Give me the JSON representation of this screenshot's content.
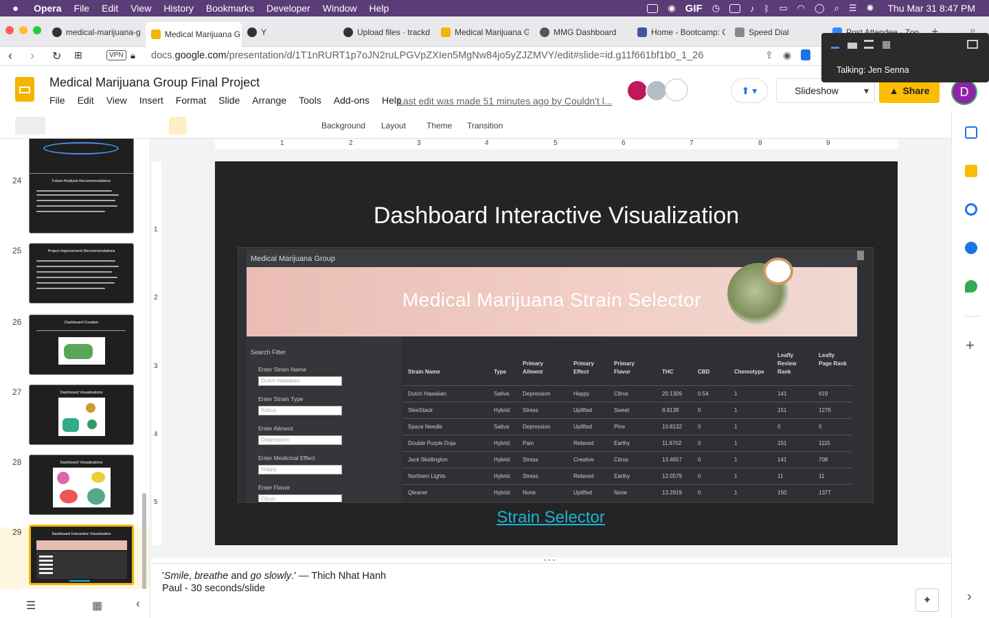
{
  "macos_menubar": {
    "app": "Opera",
    "menus": [
      "File",
      "Edit",
      "View",
      "History",
      "Bookmarks",
      "Developer",
      "Window",
      "Help"
    ],
    "datetime": "Thu Mar 31  8:47 PM"
  },
  "browser": {
    "tabs": [
      {
        "label": "medical-marijuana-g",
        "icon": "github-icon"
      },
      {
        "label": "Medical Marijuana G",
        "icon": "slides-icon",
        "active": true
      },
      {
        "label": "Y",
        "icon": "github-icon"
      },
      {
        "label": "Upload files · trackd",
        "icon": "github-icon"
      },
      {
        "label": "Medical Marijuana G",
        "icon": "slides-icon"
      },
      {
        "label": "MMG Dashboard",
        "icon": "globe-icon"
      },
      {
        "label": "Home - Bootcamp: C",
        "icon": "bootcamp-icon"
      },
      {
        "label": "Speed Dial",
        "icon": "grid-icon"
      },
      {
        "label": "Post Attendee - Zoo",
        "icon": "zoom-icon"
      }
    ],
    "vpn_label": "VPN",
    "url_prefix": "docs.",
    "url_domain": "google.com",
    "url_path": "/presentation/d/1T1nRURT1p7oJN2ruLPGVpZXIen5MgNw84jo5yZJZMVY/edit#slide=id.g11f661bf1b0_1_26"
  },
  "zoom_popup": {
    "talking": "Talking: Jen Senna"
  },
  "document": {
    "title": "Medical Marijuana Group Final Project",
    "menus": [
      "File",
      "Edit",
      "View",
      "Insert",
      "Format",
      "Slide",
      "Arrange",
      "Tools",
      "Add-ons",
      "Help"
    ],
    "last_edit": "Last edit was made 51 minutes ago by Couldn't l...",
    "slideshow_label": "Slideshow",
    "share_label": "Share",
    "avatar_letter": "D"
  },
  "toolbar": {
    "background": "Background",
    "layout": "Layout",
    "theme": "Theme",
    "transition": "Transition"
  },
  "ruler": {
    "h_ticks": [
      "1",
      "2",
      "3",
      "4",
      "5",
      "6",
      "7",
      "8",
      "9"
    ],
    "v_ticks": [
      "1",
      "2",
      "3",
      "4",
      "5"
    ]
  },
  "filmstrip": [
    {
      "num": "24",
      "title": "Future Analysis Recommendations"
    },
    {
      "num": "25",
      "title": "Project Improvement Recommendations"
    },
    {
      "num": "26",
      "title": "Dashboard Creation"
    },
    {
      "num": "27",
      "title": "Dashboard Visualizations"
    },
    {
      "num": "28",
      "title": "Dashboard Visualizations"
    },
    {
      "num": "29",
      "title": "Dashboard Interactive Visualization",
      "selected": true
    }
  ],
  "slide": {
    "title": "Dashboard Interactive Visualization",
    "link_text": "Strain Selector",
    "dashboard": {
      "header": "Medical Marijuana Group",
      "banner": "Medical Marijuana Strain Selector",
      "filter_title": "Search Filter",
      "filters": [
        {
          "label": "Enter Strain Name",
          "value": "Dutch Hawaiian"
        },
        {
          "label": "Enter Strain Type",
          "value": "Sativa"
        },
        {
          "label": "Enter Ailment",
          "value": "Depression"
        },
        {
          "label": "Enter Medicinal Effect",
          "value": "Happy"
        },
        {
          "label": "Enter Flavor",
          "value": "Citrus"
        }
      ],
      "columns": [
        "Strain Name",
        "Type",
        "Primary Ailment",
        "Primary Effect",
        "Primary Flavor",
        "THC",
        "CBD",
        "Chemotype",
        "Leafly Review Rank",
        "Leafly Page Rank"
      ],
      "rows": [
        [
          "Dutch Hawaiian",
          "Sativa",
          "Depression",
          "Happy",
          "Citrus",
          "20.1309",
          "0.54",
          "1",
          "141",
          "619"
        ],
        [
          "SleeStack",
          "Hybrid",
          "Stress",
          "Uplifted",
          "Sweet",
          "9.9139",
          "0",
          "1",
          "151",
          "1276"
        ],
        [
          "Space Needle",
          "Sativa",
          "Depression",
          "Uplifted",
          "Pine",
          "10.8132",
          "0",
          "1",
          "0",
          "0"
        ],
        [
          "Double Purple Doja",
          "Hybrid",
          "Pain",
          "Relaxed",
          "Earthy",
          "11.6702",
          "0",
          "1",
          "151",
          "1115"
        ],
        [
          "Jack Skellington",
          "Hybrid",
          "Stress",
          "Creative",
          "Citrus",
          "13.4657",
          "0",
          "1",
          "141",
          "708"
        ],
        [
          "Northern Lights",
          "Hybrid",
          "Stress",
          "Relaxed",
          "Earthy",
          "12.0579",
          "0",
          "1",
          "11",
          "11"
        ],
        [
          "Qleaner",
          "Hybrid",
          "None",
          "Uplifted",
          "None",
          "13.2919",
          "0",
          "1",
          "150",
          "1377"
        ]
      ]
    }
  },
  "notes": {
    "line1_a": "'",
    "line1_smile": "Smile",
    "line1_b": ", ",
    "line1_breathe": "breathe",
    "line1_c": " and ",
    "line1_slowly": "go slowly",
    "line1_d": ".' — Thich Nhat Hanh",
    "line2": "Paul - 30 seconds/slide"
  }
}
